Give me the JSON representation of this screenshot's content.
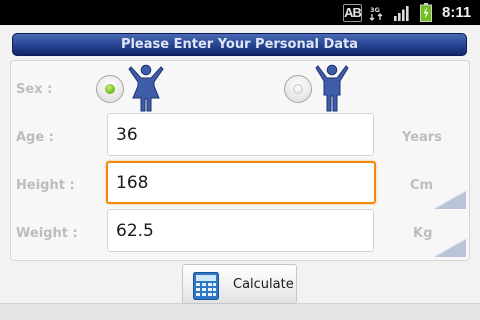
{
  "status_bar": {
    "keyboard_badge": "AB",
    "network_label": "3G",
    "signal_icon": "signal-bars-icon",
    "battery_icon": "battery-charging-icon",
    "time": "8:11"
  },
  "header": {
    "title": "Please Enter Your Personal Data"
  },
  "form": {
    "sex": {
      "label": "Sex :",
      "options": [
        {
          "name": "female",
          "selected": true,
          "icon": "female-figure-icon"
        },
        {
          "name": "male",
          "selected": false,
          "icon": "male-figure-icon"
        }
      ]
    },
    "age": {
      "label": "Age :",
      "value": "36",
      "unit": "Years"
    },
    "height": {
      "label": "Height :",
      "value": "168",
      "unit": "Cm",
      "focused": true
    },
    "weight": {
      "label": "Weight :",
      "value": "62.5",
      "unit": "Kg"
    }
  },
  "actions": {
    "calculate_label": "Calculate",
    "calculate_icon": "calculator-icon"
  },
  "colors": {
    "header_blue": "#2a4898",
    "focus_orange": "#f08a0c",
    "figure_blue": "#3e5ca8",
    "radio_green": "#7cc524",
    "label_gray": "#bdbdbd"
  }
}
